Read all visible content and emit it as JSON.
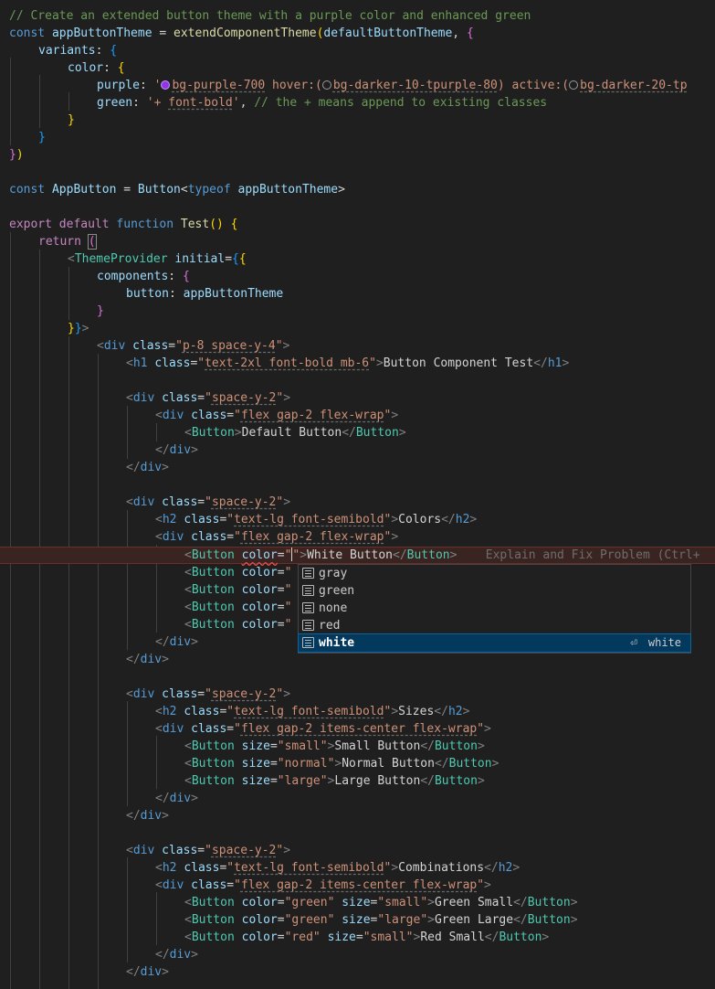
{
  "code": {
    "comment": "// Create an extended button theme with a purple color and enhanced green",
    "l2": {
      "kw": "const",
      "name": "appButtonTheme",
      "eq": " = ",
      "fn": "extendComponentTheme",
      "arg": "defaultButtonTheme",
      "tail": ", {"
    },
    "l3": {
      "key": "variants",
      "tail": ": {"
    },
    "l4": {
      "key": "color",
      "tail": ": {"
    },
    "l5": {
      "key": "purple",
      "colon": ": '",
      "c1": "bg-purple-700",
      "h": " hover:(",
      "c2": "bg-darker-10-tpurple-80",
      "a": ") active:(",
      "c3": "bg-darker-20-tp"
    },
    "l6": {
      "key": "green",
      "colon": ": '",
      "plus": "+ ",
      "bold": "font-bold",
      "q": "'",
      "comma": ", ",
      "comment": "// the + means append to existing classes"
    },
    "l7": "}",
    "l8": "}",
    "l9": "})",
    "l11": {
      "kw": "const",
      "name": "AppButton",
      "eq": " = ",
      "type": "Button",
      "lt": "<",
      "typeof": "typeof",
      "ref": " appButtonTheme",
      "gt": ">"
    },
    "l13": {
      "export": "export",
      "default": " default",
      "function": " function",
      "name": " Test",
      "paren": "()",
      "brace": " {"
    },
    "l14": {
      "ret": "return",
      "paren": " ("
    },
    "l15": {
      "lt": "<",
      "tag": "ThemeProvider",
      "attr": " initial",
      "eq": "=",
      "brace": "{",
      "brace2": "{"
    },
    "l16": {
      "key": "components",
      "tail": ": {"
    },
    "l17": {
      "key": "button",
      "colon": ": ",
      "val": "appButtonTheme"
    },
    "l18": "}",
    "l19": {
      "b": "}",
      "b2": "}",
      "gt": ">"
    },
    "l20": {
      "tag": "div",
      "cls": "p-8 space-y-4"
    },
    "l21": {
      "tag": "h1",
      "cls": "text-2xl font-bold mb-6",
      "text": "Button Component Test"
    },
    "l23": {
      "tag": "div",
      "cls": "space-y-2"
    },
    "l24": {
      "tag": "div",
      "cls": "flex gap-2 flex-wrap"
    },
    "l25": {
      "tag": "Button",
      "text": "Default Button"
    },
    "l26": "div",
    "l27": "div",
    "l29": {
      "tag": "div",
      "cls": "space-y-2"
    },
    "l30": {
      "tag": "h2",
      "cls": "text-lg font-semibold",
      "text": "Colors"
    },
    "l31": {
      "tag": "div",
      "cls": "flex gap-2 flex-wrap"
    },
    "l32": {
      "tag": "Button",
      "attr": "color",
      "text": "White Button",
      "ghost": "Explain and Fix Problem (Ctrl+"
    },
    "l33": {
      "tag": "Button",
      "attr": "color"
    },
    "l38": "div",
    "l39": "div",
    "l41": {
      "tag": "div",
      "cls": "space-y-2"
    },
    "l42": {
      "tag": "h2",
      "cls": "text-lg font-semibold",
      "text": "Sizes"
    },
    "l43": {
      "tag": "div",
      "cls": "flex gap-2 items-center flex-wrap"
    },
    "l44": {
      "tag": "Button",
      "attr": "size",
      "val": "small",
      "text": "Small Button"
    },
    "l45": {
      "tag": "Button",
      "attr": "size",
      "val": "normal",
      "text": "Normal Button"
    },
    "l46": {
      "tag": "Button",
      "attr": "size",
      "val": "large",
      "text": "Large Button"
    },
    "l47": "div",
    "l48": "div",
    "l50": {
      "tag": "div",
      "cls": "space-y-2"
    },
    "l51": {
      "tag": "h2",
      "cls": "text-lg font-semibold",
      "text": "Combinations"
    },
    "l52": {
      "tag": "div",
      "cls": "flex gap-2 items-center flex-wrap"
    },
    "l53": {
      "tag": "Button",
      "a1": "color",
      "v1": "green",
      "a2": "size",
      "v2": "small",
      "text": "Green Small"
    },
    "l54": {
      "tag": "Button",
      "a1": "color",
      "v1": "green",
      "a2": "size",
      "v2": "large",
      "text": "Green Large"
    },
    "l55": {
      "tag": "Button",
      "a1": "color",
      "v1": "red",
      "a2": "size",
      "v2": "small",
      "text": "Red Small"
    },
    "l56": "div",
    "l57": "div"
  },
  "suggest": {
    "items": [
      {
        "label": "gray",
        "icon": "enum-member-icon"
      },
      {
        "label": "green",
        "icon": "enum-member-icon"
      },
      {
        "label": "none",
        "icon": "enum-member-icon"
      },
      {
        "label": "red",
        "icon": "enum-member-icon"
      },
      {
        "label": "white",
        "icon": "enum-member-icon",
        "selected": true,
        "detail": "white",
        "enter": "⏎"
      }
    ]
  },
  "colors": {
    "background": "#1f1f1f",
    "selection": "#04395e",
    "error": "#f14c4c",
    "purple_swatch": "#9333ea"
  }
}
